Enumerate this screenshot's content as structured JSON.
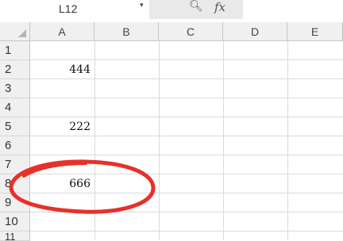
{
  "formula_bar": {
    "namebox_value": "L12",
    "dropdown_glyph": "▾",
    "zoom_icon": "magnifier-icon",
    "fx_label": "fx"
  },
  "columns": [
    "A",
    "B",
    "C",
    "D",
    "E"
  ],
  "rows": [
    "1",
    "2",
    "3",
    "4",
    "5",
    "6",
    "7",
    "8",
    "9",
    "10",
    "11"
  ],
  "cells": {
    "A2": "444",
    "A5": "222",
    "A8": "666"
  },
  "annotation": {
    "shape": "ellipse",
    "color": "#e8302a",
    "target_cell": "A8"
  }
}
